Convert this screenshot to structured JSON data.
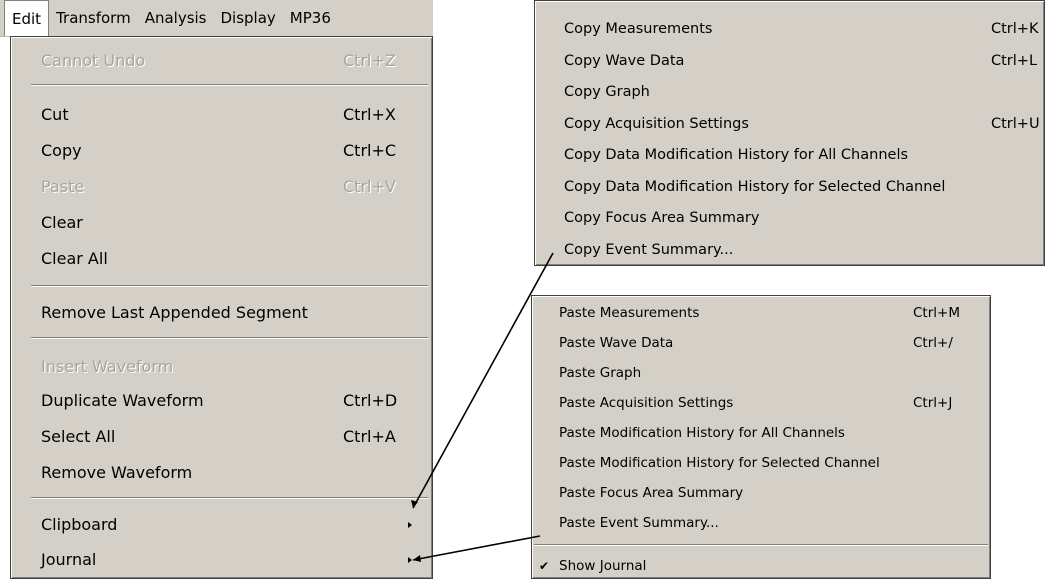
{
  "menubar": {
    "items": [
      {
        "label": "Edit"
      },
      {
        "label": "Transform"
      },
      {
        "label": "Analysis"
      },
      {
        "label": "Display"
      },
      {
        "label": "MP36"
      }
    ]
  },
  "edit_menu": {
    "undo": {
      "label": "Cannot Undo",
      "shortcut": "Ctrl+Z"
    },
    "cut": {
      "label": "Cut",
      "shortcut": "Ctrl+X"
    },
    "copy": {
      "label": "Copy",
      "shortcut": "Ctrl+C"
    },
    "paste": {
      "label": "Paste",
      "shortcut": "Ctrl+V"
    },
    "clear": {
      "label": "Clear"
    },
    "clear_all": {
      "label": "Clear All"
    },
    "remove_last": {
      "label": "Remove Last Appended Segment"
    },
    "insert_waveform": {
      "label": "Insert Waveform"
    },
    "duplicate_waveform": {
      "label": "Duplicate Waveform",
      "shortcut": "Ctrl+D"
    },
    "select_all": {
      "label": "Select All",
      "shortcut": "Ctrl+A"
    },
    "remove_waveform": {
      "label": "Remove Waveform"
    },
    "clipboard": {
      "label": "Clipboard"
    },
    "journal": {
      "label": "Journal"
    }
  },
  "clipboard_menu": {
    "items": [
      {
        "label": "Copy Measurements",
        "shortcut": "Ctrl+K"
      },
      {
        "label": "Copy Wave Data",
        "shortcut": "Ctrl+L"
      },
      {
        "label": "Copy Graph",
        "shortcut": ""
      },
      {
        "label": "Copy Acquisition Settings",
        "shortcut": "Ctrl+U"
      },
      {
        "label": "Copy Data Modification History for All Channels",
        "shortcut": ""
      },
      {
        "label": "Copy Data Modification History for Selected Channel",
        "shortcut": ""
      },
      {
        "label": "Copy Focus Area Summary",
        "shortcut": ""
      },
      {
        "label": "Copy Event Summary...",
        "shortcut": ""
      }
    ]
  },
  "journal_menu": {
    "items": [
      {
        "label": "Paste Measurements",
        "shortcut": "Ctrl+M"
      },
      {
        "label": "Paste Wave Data",
        "shortcut": "Ctrl+/"
      },
      {
        "label": "Paste Graph",
        "shortcut": ""
      },
      {
        "label": "Paste Acquisition Settings",
        "shortcut": "Ctrl+J"
      },
      {
        "label": "Paste Modification History for All Channels",
        "shortcut": ""
      },
      {
        "label": "Paste Modification History for Selected Channel",
        "shortcut": ""
      },
      {
        "label": "Paste Focus Area Summary",
        "shortcut": ""
      },
      {
        "label": "Paste Event Summary...",
        "shortcut": ""
      }
    ],
    "show_journal": {
      "label": "Show Journal",
      "checked": true
    }
  }
}
